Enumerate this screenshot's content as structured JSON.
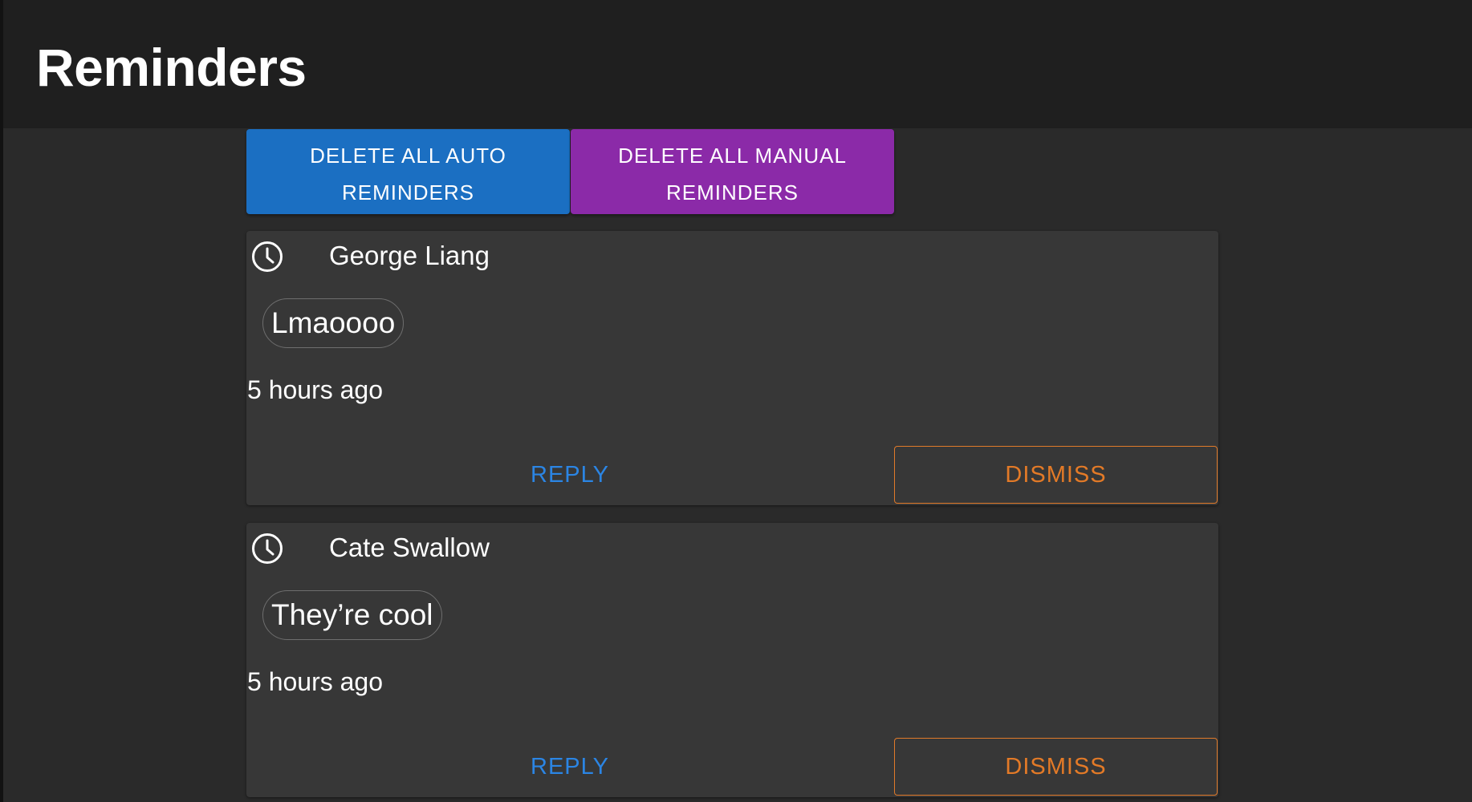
{
  "header": {
    "title": "Reminders"
  },
  "actions": {
    "delete_auto_label": "DELETE ALL AUTO REMINDERS",
    "delete_manual_label": "DELETE ALL MANUAL REMINDERS"
  },
  "reminders": [
    {
      "icon": "clock-icon",
      "sender": "George Liang",
      "message": "Lmaoooo",
      "time": "5 hours ago",
      "reply_label": "REPLY",
      "dismiss_label": "DISMISS"
    },
    {
      "icon": "clock-icon",
      "sender": "Cate Swallow",
      "message": "They’re cool",
      "time": "5 hours ago",
      "reply_label": "REPLY",
      "dismiss_label": "DISMISS"
    }
  ],
  "colors": {
    "auto_button": "#1b6fc2",
    "manual_button": "#8b2aa8",
    "reply": "#2b85e4",
    "dismiss": "#e37a27",
    "card": "#373737",
    "background": "#2a2a2a"
  }
}
